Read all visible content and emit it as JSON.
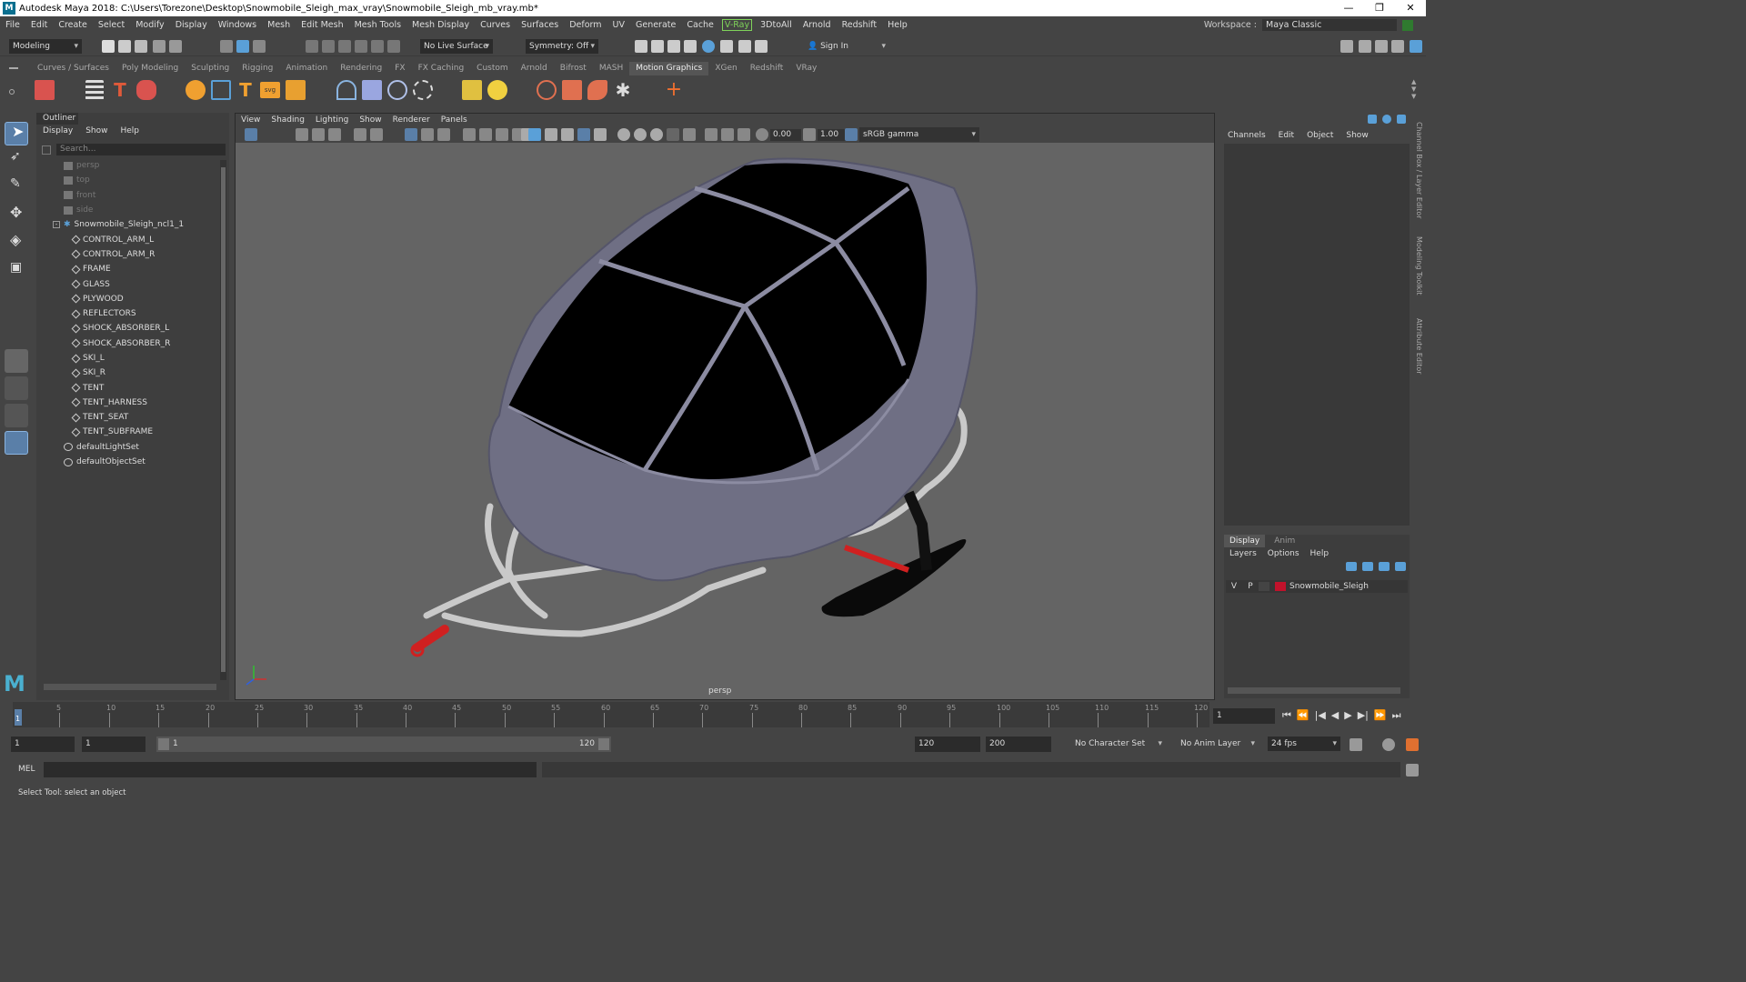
{
  "window": {
    "title": "Autodesk Maya 2018: C:\\Users\\Torezone\\Desktop\\Snowmobile_Sleigh_max_vray\\Snowmobile_Sleigh_mb_vray.mb*",
    "logo": "M"
  },
  "menubar": {
    "items": [
      "File",
      "Edit",
      "Create",
      "Select",
      "Modify",
      "Display",
      "Windows",
      "Mesh",
      "Edit Mesh",
      "Mesh Tools",
      "Mesh Display",
      "Curves",
      "Surfaces",
      "Deform",
      "UV",
      "Generate",
      "Cache",
      "V-Ray",
      "3DtoAll",
      "Arnold",
      "Redshift",
      "Help"
    ],
    "workspace_label": "Workspace :",
    "workspace_value": "Maya Classic"
  },
  "statusline": {
    "mode": "Modeling",
    "live_surface": "No Live Surface",
    "symmetry": "Symmetry: Off",
    "sign_in": "Sign In"
  },
  "shelf": {
    "tabs": [
      "Curves / Surfaces",
      "Poly Modeling",
      "Sculpting",
      "Rigging",
      "Animation",
      "Rendering",
      "FX",
      "FX Caching",
      "Custom",
      "Arnold",
      "Bifrost",
      "MASH",
      "Motion Graphics",
      "XGen",
      "Redshift",
      "VRay"
    ],
    "active_tab": "Motion Graphics"
  },
  "outliner": {
    "title": "Outliner",
    "menus": [
      "Display",
      "Show",
      "Help"
    ],
    "search_placeholder": "Search...",
    "cameras": [
      "persp",
      "top",
      "front",
      "side"
    ],
    "root": "Snowmobile_Sleigh_ncl1_1",
    "children": [
      "CONTROL_ARM_L",
      "CONTROL_ARM_R",
      "FRAME",
      "GLASS",
      "PLYWOOD",
      "REFLECTORS",
      "SHOCK_ABSORBER_L",
      "SHOCK_ABSORBER_R",
      "SKI_L",
      "SKI_R",
      "TENT",
      "TENT_HARNESS",
      "TENT_SEAT",
      "TENT_SUBFRAME"
    ],
    "sets": [
      "defaultLightSet",
      "defaultObjectSet"
    ]
  },
  "viewport": {
    "menus": [
      "View",
      "Shading",
      "Lighting",
      "Show",
      "Renderer",
      "Panels"
    ],
    "exposure": "0.00",
    "gamma": "1.00",
    "color_space": "sRGB gamma",
    "camera_label": "persp"
  },
  "channelbox": {
    "menus": [
      "Channels",
      "Edit",
      "Object",
      "Show"
    ],
    "side_tabs": [
      "Channel Box / Layer Editor",
      "Modeling Toolkit",
      "Attribute Editor"
    ]
  },
  "layers": {
    "tabs": [
      "Display",
      "Anim"
    ],
    "active_tab": "Display",
    "menus": [
      "Layers",
      "Options",
      "Help"
    ],
    "rows": [
      {
        "v": "V",
        "p": "P",
        "name": "Snowmobile_Sleigh",
        "color": "#c0122b"
      }
    ]
  },
  "timeline": {
    "ticks": [
      "5",
      "10",
      "15",
      "20",
      "25",
      "30",
      "35",
      "40",
      "45",
      "50",
      "55",
      "60",
      "65",
      "70",
      "75",
      "80",
      "85",
      "90",
      "95",
      "100",
      "105",
      "110",
      "115",
      "120"
    ],
    "current_frame_marker": "1",
    "current_frame": "1"
  },
  "range": {
    "start": "1",
    "playback_start": "1",
    "slider_start": "1",
    "slider_end": "120",
    "playback_end": "120",
    "end": "200",
    "character_set": "No Character Set",
    "anim_layer": "No Anim Layer",
    "fps": "24 fps"
  },
  "command": {
    "label": "MEL"
  },
  "help_line": "Select Tool: select an object",
  "colors": {
    "accent": "#5aa0d8",
    "vray": "#7fd35a",
    "layer_color": "#c0122b"
  }
}
